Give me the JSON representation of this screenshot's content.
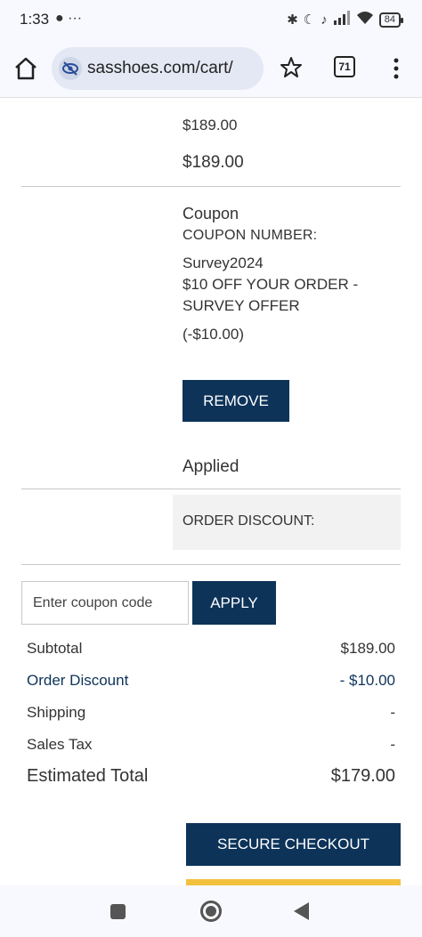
{
  "status_bar": {
    "time": "1:33",
    "left_icons": "● ···",
    "battery": "84"
  },
  "browser": {
    "url": "sasshoes.com/cart/",
    "tab_count": "71"
  },
  "cart": {
    "line_price": "$189.00",
    "line_total": "$189.00",
    "coupon": {
      "title": "Coupon",
      "number_label": "COUPON NUMBER:",
      "code": "Survey2024",
      "description_line1": "$10 OFF YOUR ORDER -",
      "description_line2": "SURVEY OFFER",
      "amount": "(-$10.00)",
      "remove_label": "REMOVE",
      "status": "Applied"
    },
    "order_discount_label": "ORDER DISCOUNT:",
    "coupon_entry": {
      "placeholder": "Enter coupon code",
      "apply_label": "APPLY"
    },
    "summary": {
      "subtotal_label": "Subtotal",
      "subtotal_value": "$189.00",
      "discount_label": "Order Discount",
      "discount_value": "- $10.00",
      "shipping_label": "Shipping",
      "shipping_value": "-",
      "tax_label": "Sales Tax",
      "tax_value": "-",
      "total_label": "Estimated Total",
      "total_value": "$179.00"
    },
    "checkout_label": "SECURE CHECKOUT"
  },
  "colors": {
    "navy": "#0d3359",
    "yellow": "#f3c13d"
  }
}
